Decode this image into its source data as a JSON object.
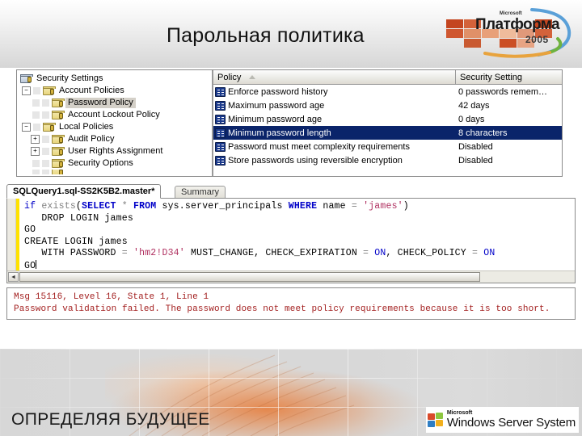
{
  "slide": {
    "title": "Парольная политика",
    "logo": {
      "microsoft": "Microsoft",
      "brand": "Платформа",
      "year": "2005"
    }
  },
  "security_console": {
    "tree": {
      "root_label": "Security Settings",
      "nodes": [
        {
          "label": "Security Settings",
          "depth": 0,
          "expander": "none",
          "icon": "console-root-icon",
          "selected": false
        },
        {
          "label": "Account Policies",
          "depth": 1,
          "expander": "minus",
          "icon": "policy-folder-icon",
          "selected": false
        },
        {
          "label": "Password Policy",
          "depth": 2,
          "expander": "none",
          "icon": "policy-folder-icon",
          "selected": true
        },
        {
          "label": "Account Lockout Policy",
          "depth": 2,
          "expander": "none",
          "icon": "policy-folder-icon",
          "selected": false
        },
        {
          "label": "Local Policies",
          "depth": 1,
          "expander": "minus",
          "icon": "policy-folder-icon",
          "selected": false
        },
        {
          "label": "Audit Policy",
          "depth": 2,
          "expander": "plus",
          "icon": "policy-folder-icon",
          "selected": false
        },
        {
          "label": "User Rights Assignment",
          "depth": 2,
          "expander": "plus",
          "icon": "policy-folder-icon",
          "selected": false
        },
        {
          "label": "Security Options",
          "depth": 2,
          "expander": "none",
          "icon": "policy-folder-icon",
          "selected": false
        }
      ]
    },
    "list": {
      "columns": [
        "Policy",
        "Security Setting"
      ],
      "sort_column": "Policy",
      "rows": [
        {
          "policy": "Enforce password history",
          "setting": "0 passwords remem…",
          "selected": false
        },
        {
          "policy": "Maximum password age",
          "setting": "42 days",
          "selected": false
        },
        {
          "policy": "Minimum password age",
          "setting": "0 days",
          "selected": false
        },
        {
          "policy": "Minimum password length",
          "setting": "8 characters",
          "selected": true
        },
        {
          "policy": "Password must meet complexity requirements",
          "setting": "Disabled",
          "selected": false
        },
        {
          "policy": "Store passwords using reversible encryption",
          "setting": "Disabled",
          "selected": false
        }
      ]
    },
    "selection_color": "#0a246a"
  },
  "ssms": {
    "tabs": [
      {
        "label": "SQLQuery1.sql-SS2K5B2.master*",
        "active": true
      },
      {
        "label": "Summary",
        "active": false
      }
    ],
    "code_lines": [
      "if exists(SELECT * FROM sys.server_principals WHERE name = 'james')",
      "   DROP LOGIN james",
      "GO",
      "CREATE LOGIN james",
      "   WITH PASSWORD = 'hm2!D34' MUST_CHANGE, CHECK_EXPIRATION = ON, CHECK_POLICY = ON",
      "GO"
    ],
    "results": {
      "line1": "Msg 15116, Level 16, State 1, Line 1",
      "line2": "Password validation failed. The password does not meet policy requirements because it is too short.",
      "error_color": "#a32020"
    },
    "scrollbar": {
      "left_arrow": "◄"
    }
  },
  "footer": {
    "tagline": "ОПРЕДЕЛЯЯ БУДУЩЕЕ",
    "product": {
      "microsoft": "Microsoft",
      "name": "Windows Server System"
    }
  }
}
